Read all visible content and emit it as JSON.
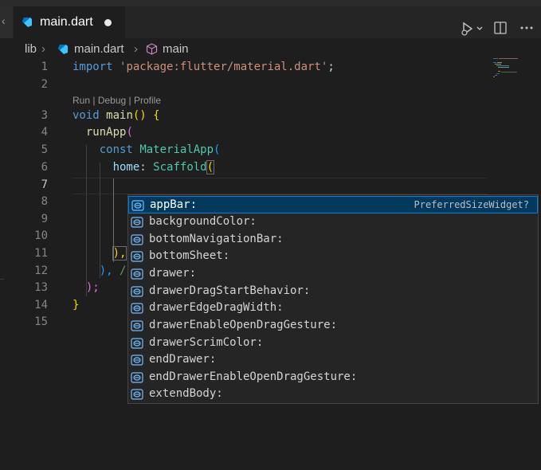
{
  "tab": {
    "filename": "main.dart"
  },
  "breadcrumb": {
    "folder": "lib",
    "file": "main.dart",
    "symbol": "main"
  },
  "codelens": {
    "run": "Run",
    "debug": "Debug",
    "profile": "Profile",
    "sep": " | "
  },
  "lines": [
    "1",
    "2",
    "3",
    "4",
    "5",
    "6",
    "7",
    "8",
    "9",
    "10",
    "11",
    "12",
    "13",
    "14",
    "15"
  ],
  "code": {
    "l1_kw": "import",
    "l1_str": "'package:flutter/material.dart'",
    "l1_end": ";",
    "l3_kw": "void",
    "l3_fn": "main",
    "l3_paren": "()",
    "l3_brace": "{",
    "l4_fn": "runApp",
    "l4_paren": "(",
    "l5_kw": "const",
    "l5_cls": "MaterialApp",
    "l5_paren": "(",
    "l6_prop": "home",
    "l6_colon": ":",
    "l6_cls": "Scaffold",
    "l6_paren": "(",
    "l11": "),",
    "l12": "),",
    "l12_tail": "/",
    "l13": ");",
    "l14": "}"
  },
  "suggestions": {
    "items": [
      {
        "label": "appBar:",
        "detail": "PreferredSizeWidget?"
      },
      {
        "label": "backgroundColor:",
        "detail": ""
      },
      {
        "label": "bottomNavigationBar:",
        "detail": ""
      },
      {
        "label": "bottomSheet:",
        "detail": ""
      },
      {
        "label": "drawer:",
        "detail": ""
      },
      {
        "label": "drawerDragStartBehavior:",
        "detail": ""
      },
      {
        "label": "drawerEdgeDragWidth:",
        "detail": ""
      },
      {
        "label": "drawerEnableOpenDragGesture:",
        "detail": ""
      },
      {
        "label": "drawerScrimColor:",
        "detail": ""
      },
      {
        "label": "endDrawer:",
        "detail": ""
      },
      {
        "label": "endDrawerEnableOpenDragGesture:",
        "detail": ""
      },
      {
        "label": "extendBody:",
        "detail": ""
      }
    ]
  },
  "icons": {
    "dart": "dart-file-icon",
    "symbol": "method-cube-icon",
    "run": "run-debug-icon",
    "split": "split-editor-icon",
    "more": "more-actions-icon",
    "field": "field-symbol-icon"
  },
  "colors": {
    "accent": "#007fd4",
    "selected_bg": "#04395e",
    "dart_blue": "#40c4ff"
  }
}
